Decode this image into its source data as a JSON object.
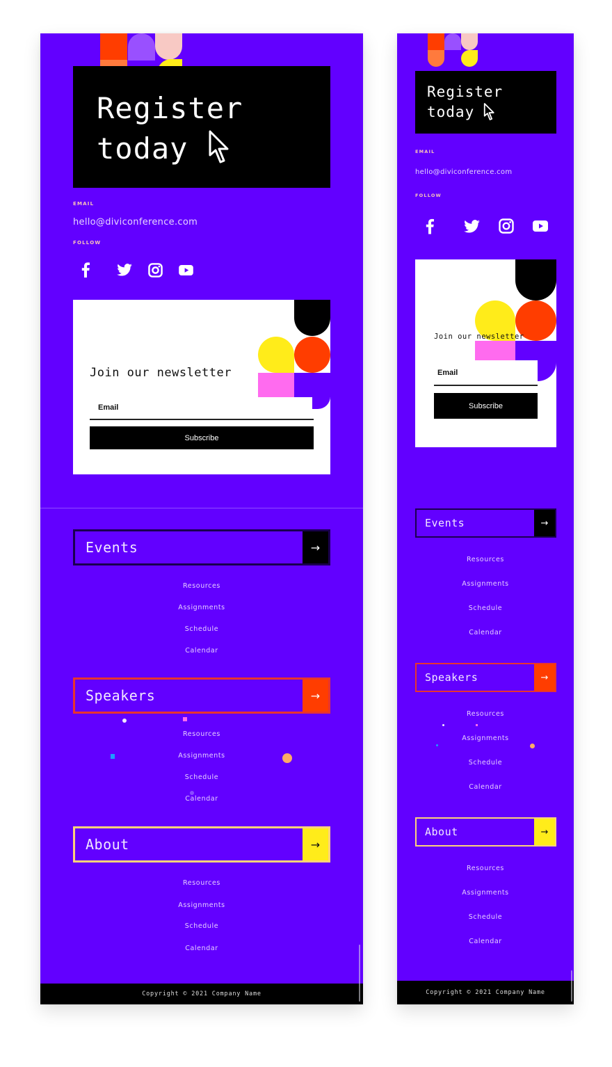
{
  "colors": {
    "background": "#6200ff",
    "black": "#000000",
    "events_accent": "#000000",
    "speakers_accent": "#ff3d00",
    "speakers_border": "#e8342e",
    "about_accent": "#ffec1a",
    "about_border": "#ffd27a",
    "label_pink": "#f9c6b8"
  },
  "register": {
    "line1": "Register",
    "line2": "today"
  },
  "contact": {
    "email_label": "EMAIL",
    "email": "hello@diviconference.com",
    "follow_label": "FOLLOW",
    "social": [
      {
        "name": "facebook",
        "icon": "facebook-icon"
      },
      {
        "name": "twitter",
        "icon": "twitter-icon"
      },
      {
        "name": "instagram",
        "icon": "instagram-icon"
      },
      {
        "name": "youtube",
        "icon": "youtube-icon"
      }
    ]
  },
  "newsletter": {
    "title": "Join our newsletter",
    "email_placeholder": "Email",
    "subscribe_label": "Subscribe"
  },
  "nav": [
    {
      "label": "Events",
      "arrow": "→",
      "links": [
        "Resources",
        "Assignments",
        "Schedule",
        "Calendar"
      ]
    },
    {
      "label": "Speakers",
      "arrow": "→",
      "links": [
        "Resources",
        "Assignments",
        "Schedule",
        "Calendar"
      ]
    },
    {
      "label": "About",
      "arrow": "→",
      "links": [
        "Resources",
        "Assignments",
        "Schedule",
        "Calendar"
      ]
    }
  ],
  "footer": {
    "copyright": "Copyright © 2021 Company Name"
  }
}
